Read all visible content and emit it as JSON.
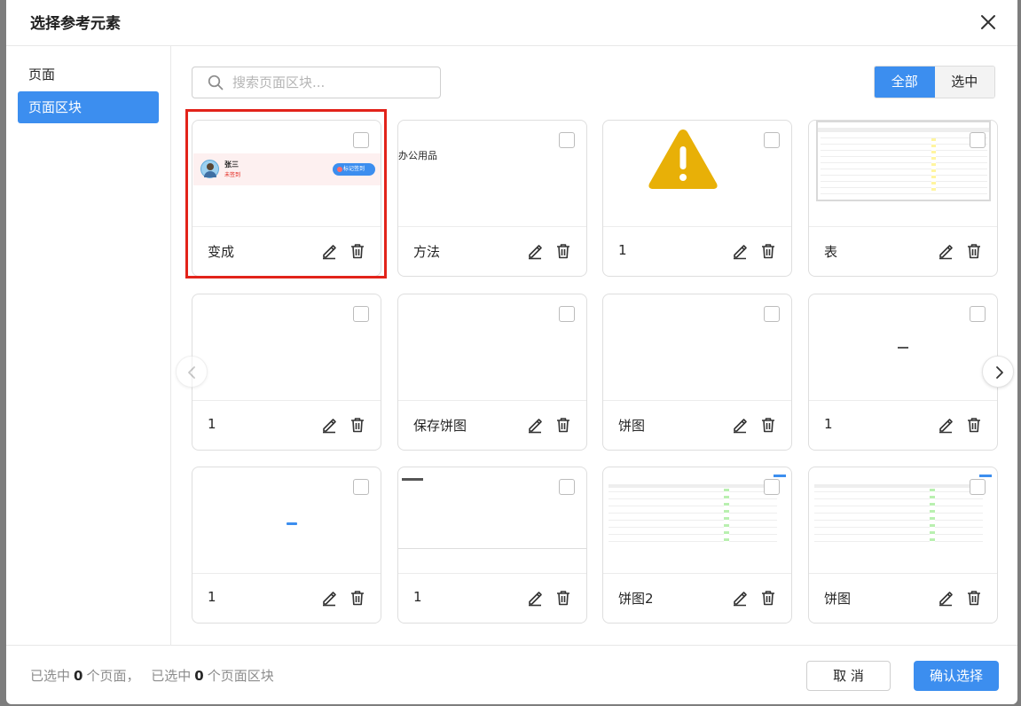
{
  "dialog": {
    "title": "选择参考元素"
  },
  "sidebar": {
    "items": [
      {
        "label": "页面"
      },
      {
        "label": "页面区块"
      }
    ]
  },
  "search": {
    "placeholder": "搜索页面区块..."
  },
  "filter": {
    "all": "全部",
    "selected": "选中"
  },
  "cards": [
    {
      "label": "变成",
      "preview": {
        "name": "张三",
        "status": "未签到",
        "button": "标记签到"
      }
    },
    {
      "label": "方法",
      "preview": {
        "text": "办公用品"
      }
    },
    {
      "label": "1",
      "preview": {
        "icon": "warning-icon"
      }
    },
    {
      "label": "表"
    },
    {
      "label": "1"
    },
    {
      "label": "保存饼图"
    },
    {
      "label": "饼图"
    },
    {
      "label": "1"
    },
    {
      "label": "1"
    },
    {
      "label": "1"
    },
    {
      "label": "饼图2"
    },
    {
      "label": "饼图"
    }
  ],
  "footer": {
    "status_prefix": "已选中",
    "pages_count": "0",
    "pages_suffix": "个页面，",
    "status_prefix2": "已选中",
    "blocks_count": "0",
    "blocks_suffix": "个页面区块",
    "cancel": "取 消",
    "confirm": "确认选择"
  },
  "colors": {
    "accent": "#3c8eef",
    "highlight": "#e2231a",
    "warning": "#e8b007"
  }
}
